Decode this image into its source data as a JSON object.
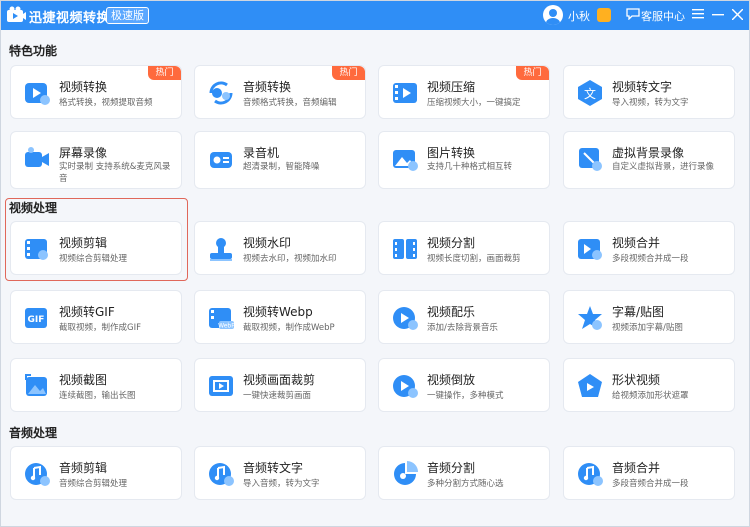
{
  "app": {
    "title": "迅捷视频转换器",
    "edition": "极速版",
    "user_name": "小秋",
    "service_label": "客服中心"
  },
  "colors": {
    "accent": "#2f8ef6",
    "hot": "#ff6a3d",
    "selected": "#e0675a"
  },
  "sections": {
    "featured": "特色功能",
    "video": "视频处理",
    "audio": "音频处理"
  },
  "featured": [
    {
      "name": "视频转换",
      "desc": "格式转换，视频提取音频",
      "hot": "热门",
      "icon": "video-convert-icon"
    },
    {
      "name": "音频转换",
      "desc": "音频格式转换，音频编辑",
      "hot": "热门",
      "icon": "audio-convert-icon"
    },
    {
      "name": "视频压缩",
      "desc": "压缩视频大小，一键搞定",
      "hot": "热门",
      "icon": "video-compress-icon"
    },
    {
      "name": "视频转文字",
      "desc": "导入视频，转为文字",
      "hot": "",
      "icon": "video-to-text-icon"
    },
    {
      "name": "屏幕录像",
      "desc": "实时录制 支持系统&麦克风录音",
      "hot": "",
      "icon": "screen-record-icon"
    },
    {
      "name": "录音机",
      "desc": "超清录制，智能降噪",
      "hot": "",
      "icon": "recorder-icon"
    },
    {
      "name": "图片转换",
      "desc": "支持几十种格式相互转",
      "hot": "",
      "icon": "image-convert-icon"
    },
    {
      "name": "虚拟背景录像",
      "desc": "自定义虚拟背景，进行录像",
      "hot": "",
      "icon": "virtual-bg-icon"
    }
  ],
  "video": [
    {
      "name": "视频剪辑",
      "desc": "视频综合剪辑处理",
      "icon": "video-edit-icon"
    },
    {
      "name": "视频水印",
      "desc": "视频去水印，视频加水印",
      "icon": "watermark-icon"
    },
    {
      "name": "视频分割",
      "desc": "视频长度切割，画面裁剪",
      "icon": "video-split-icon"
    },
    {
      "name": "视频合并",
      "desc": "多段视频合并成一段",
      "icon": "video-merge-icon"
    },
    {
      "name": "视频转GIF",
      "desc": "截取视频，制作成GIF",
      "icon": "gif-icon"
    },
    {
      "name": "视频转Webp",
      "desc": "截取视频，制作成WebP",
      "icon": "webp-icon"
    },
    {
      "name": "视频配乐",
      "desc": "添加/去除背景音乐",
      "icon": "video-music-icon"
    },
    {
      "name": "字幕/贴图",
      "desc": "视频添加字幕/贴图",
      "icon": "subtitle-sticker-icon"
    },
    {
      "name": "视频截图",
      "desc": "连续截图，输出长图",
      "icon": "screenshot-icon"
    },
    {
      "name": "视频画面裁剪",
      "desc": "一键快速裁剪画面",
      "icon": "crop-icon"
    },
    {
      "name": "视频倒放",
      "desc": "一键操作，多种模式",
      "icon": "reverse-icon"
    },
    {
      "name": "形状视频",
      "desc": "给视频添加形状遮罩",
      "icon": "shape-video-icon"
    }
  ],
  "audio": [
    {
      "name": "音频剪辑",
      "desc": "音频综合剪辑处理",
      "icon": "audio-edit-icon"
    },
    {
      "name": "音频转文字",
      "desc": "导入音频，转为文字",
      "icon": "audio-to-text-icon"
    },
    {
      "name": "音频分割",
      "desc": "多种分割方式随心选",
      "icon": "audio-split-icon"
    },
    {
      "name": "音频合并",
      "desc": "多段音频合并成一段",
      "icon": "audio-merge-icon"
    }
  ]
}
